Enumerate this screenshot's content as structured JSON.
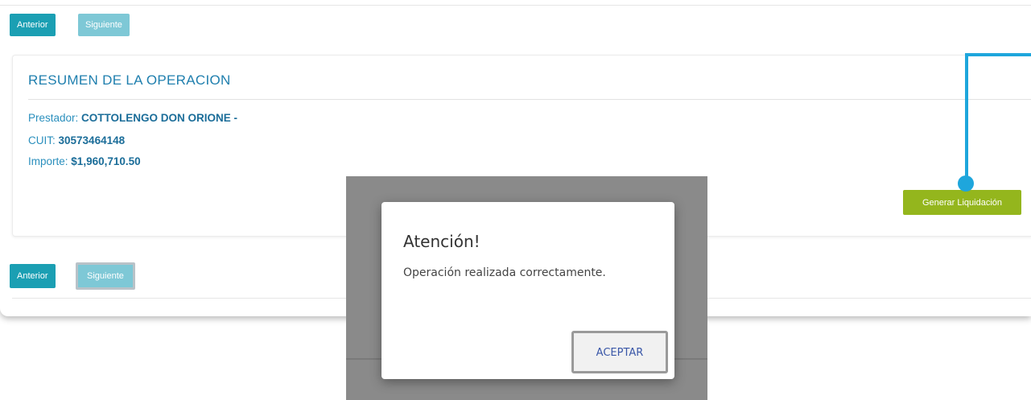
{
  "nav_top": {
    "prev_label": "Anterior",
    "next_label": "Siguiente"
  },
  "summary": {
    "title": "RESUMEN DE LA OPERACION",
    "provider_label": "Prestador:",
    "provider_value": "COTTOLENGO DON ORIONE -",
    "cuit_label": "CUIT:",
    "cuit_value": "30573464148",
    "amount_label": "Importe:",
    "amount_value": "$1,960,710.50",
    "generate_label": "Generar Liquidación"
  },
  "nav_bottom": {
    "prev_label": "Anterior",
    "next_label": "Siguiente"
  },
  "dialog": {
    "title": "Atención!",
    "message": "Operación realizada correctamente.",
    "accept_label": "ACEPTAR"
  },
  "colors": {
    "primary": "#1b9fb3",
    "primary_light": "#7ec8d6",
    "title_blue": "#1f7fae",
    "generate_green": "#94b61d",
    "annotation_blue": "#1ea6dc"
  }
}
